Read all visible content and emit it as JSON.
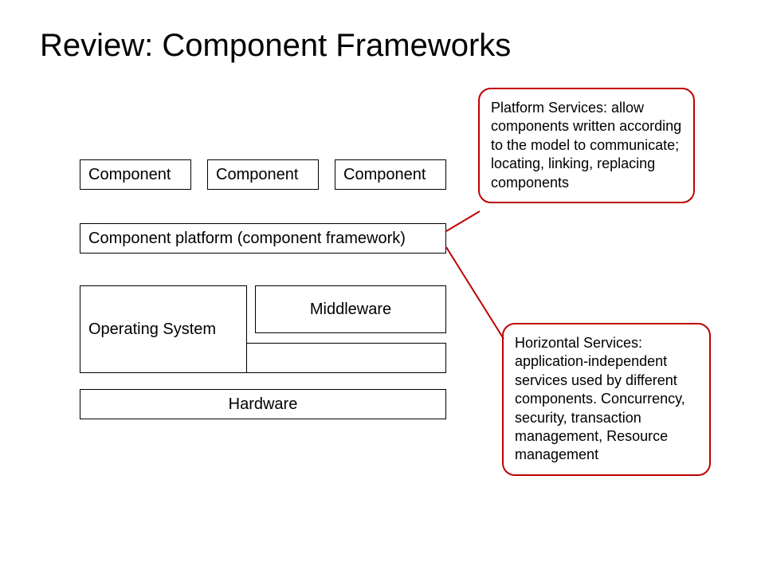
{
  "title": "Review: Component Frameworks",
  "boxes": {
    "component1": "Component",
    "component2": "Component",
    "component3": "Component",
    "platform": "Component platform (component framework)",
    "os": "Operating System",
    "middleware": "Middleware",
    "hardware": "Hardware"
  },
  "callouts": {
    "platform_services": "Platform Services: allow components written according to the model to communicate;  locating, linking, replacing components",
    "horizontal_services": "Horizontal Services: application-independent services used by different components. Concurrency, security, transaction management, Resource management"
  }
}
